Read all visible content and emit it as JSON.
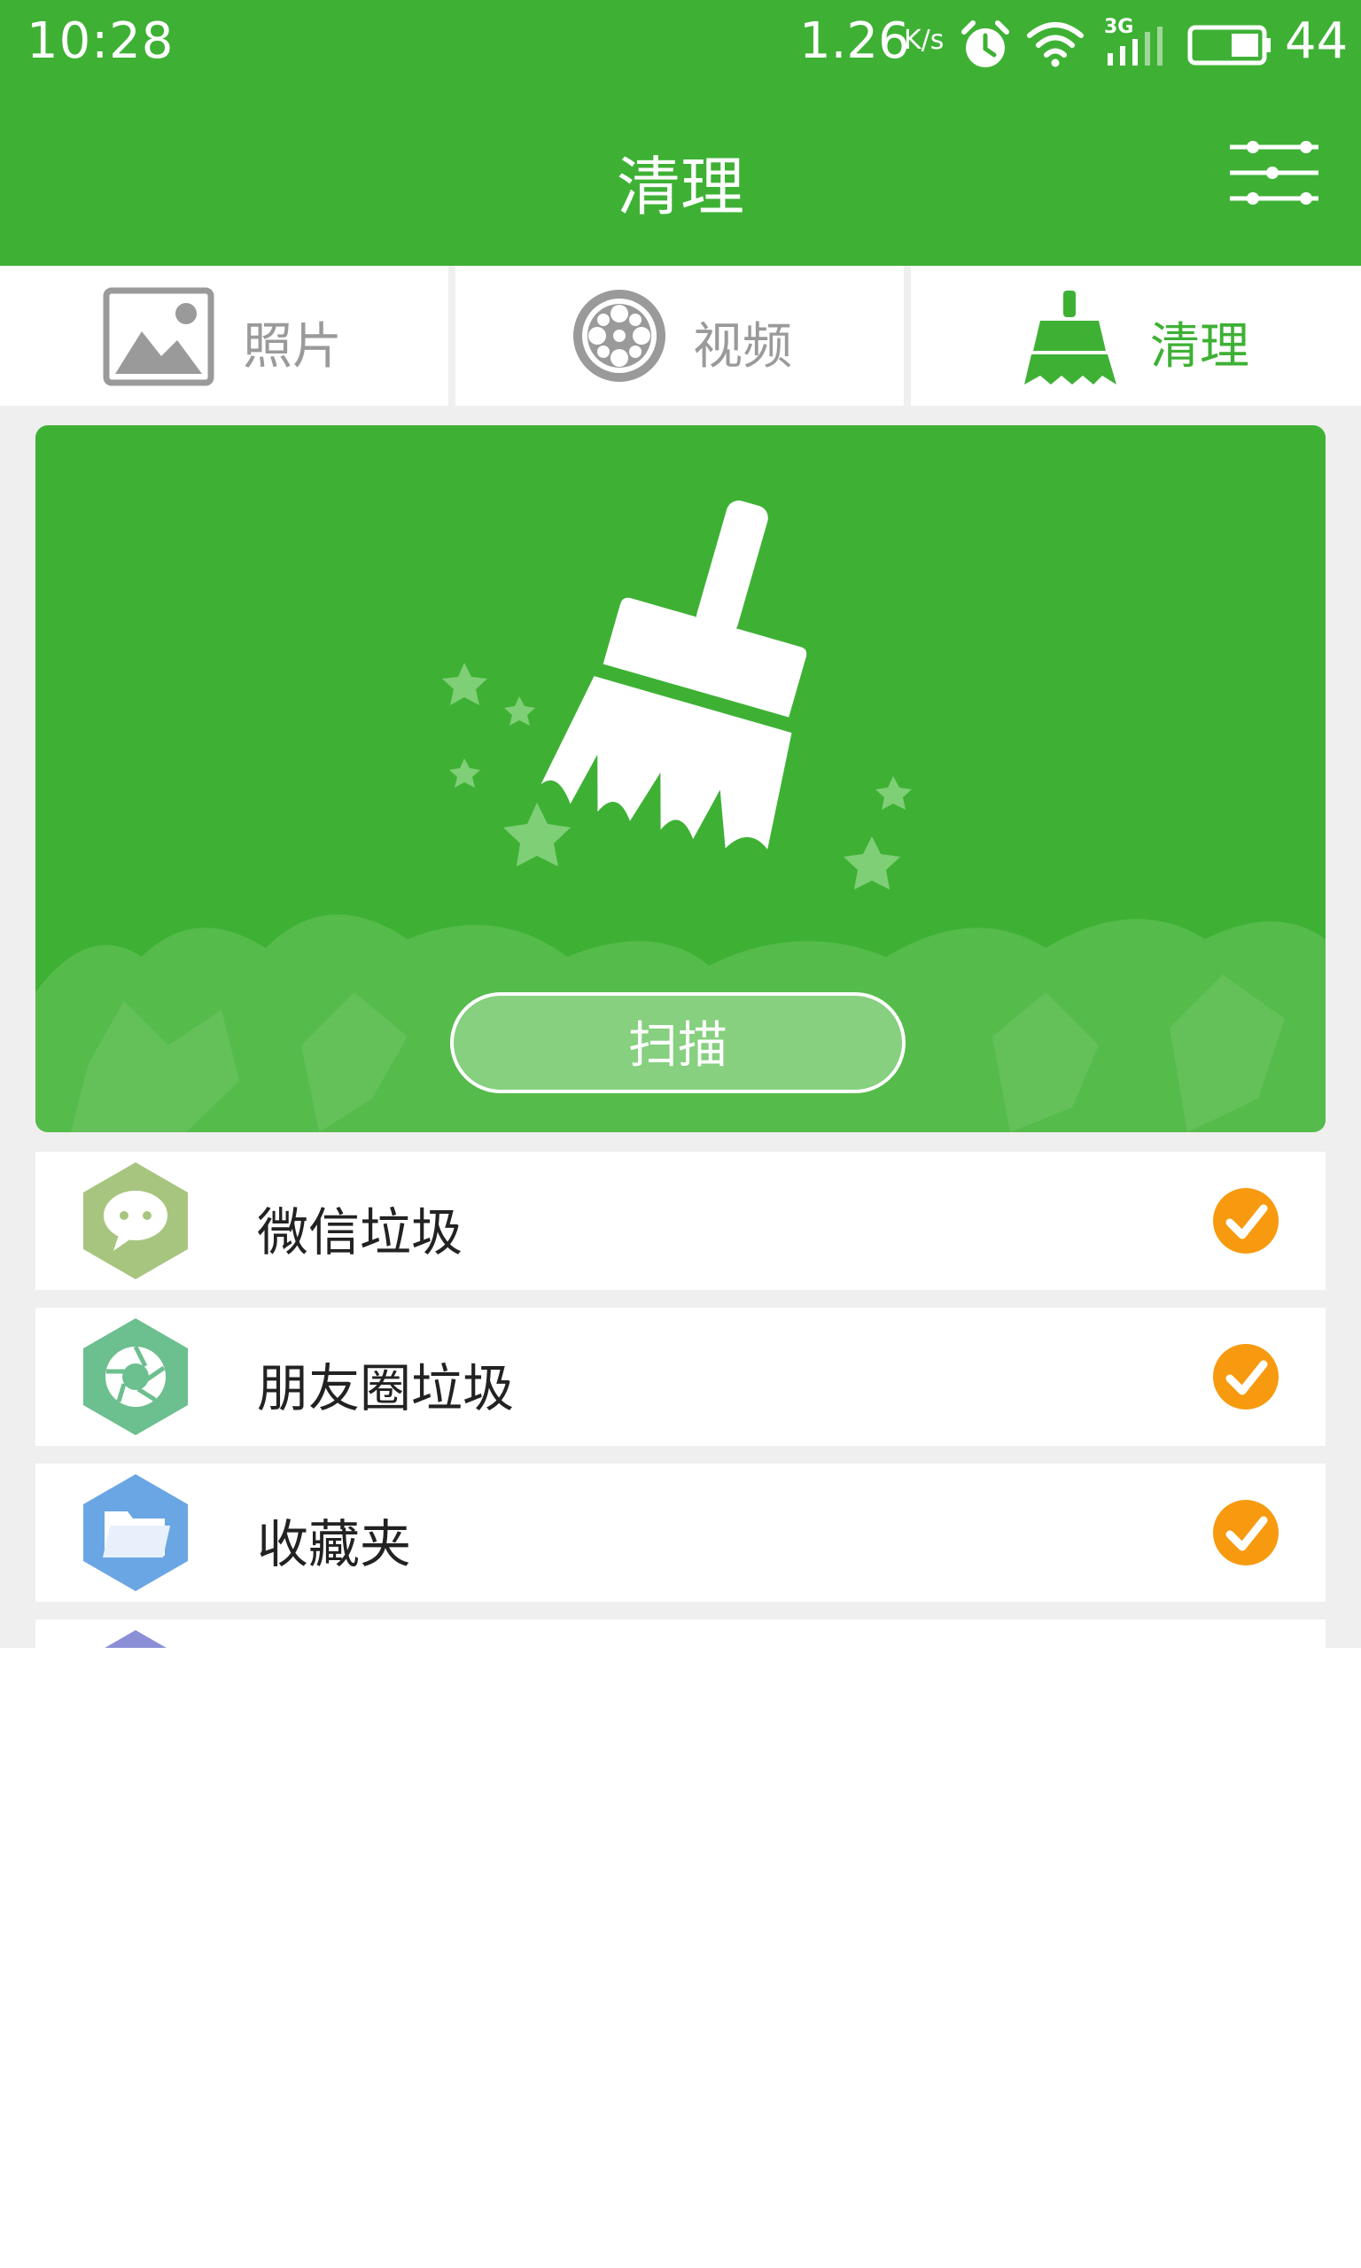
{
  "status_bar": {
    "time": "10:28",
    "network_speed": "1.26",
    "network_speed_unit": "K/s",
    "network_type": "3G",
    "battery": "44",
    "icons": [
      "alarm-icon",
      "wifi-icon",
      "signal-icon",
      "battery-icon"
    ]
  },
  "header": {
    "title": "清理",
    "settings_icon": "sliders-icon"
  },
  "tabs": [
    {
      "label": "照片",
      "icon": "photo-icon",
      "active": false
    },
    {
      "label": "视频",
      "icon": "film-reel-icon",
      "active": false
    },
    {
      "label": "清理",
      "icon": "broom-icon",
      "active": true
    }
  ],
  "hero": {
    "icon": "broom-icon",
    "button_label": "扫描"
  },
  "list": {
    "items": [
      {
        "label": "微信垃圾",
        "icon": "chat-bubble-icon",
        "icon_color": "#a8c57f",
        "checked": true
      },
      {
        "label": "朋友圈垃圾",
        "icon": "aperture-icon",
        "icon_color": "#6cbf8e",
        "checked": true
      },
      {
        "label": "收藏夹",
        "icon": "folder-icon",
        "icon_color": "#6aa6e3",
        "checked": true
      }
    ]
  },
  "colors": {
    "accent": "#3eb135",
    "check": "#f79a0f",
    "tab_inactive": "#9a9a9a",
    "background": "#efefef"
  }
}
